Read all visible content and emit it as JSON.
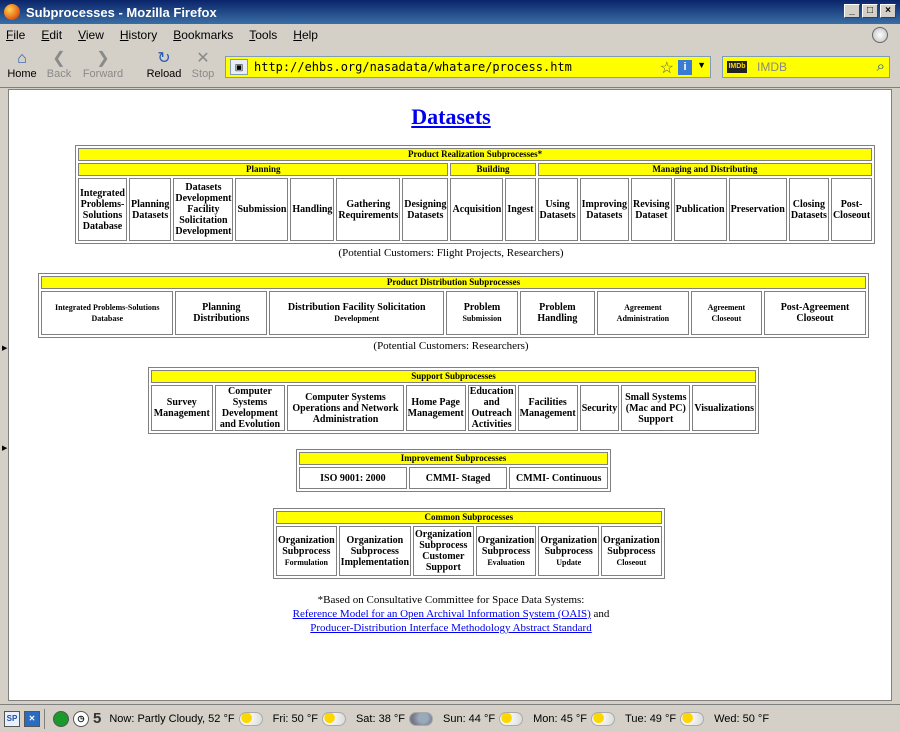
{
  "window": {
    "title": "Subprocesses - Mozilla Firefox"
  },
  "menu": [
    "File",
    "Edit",
    "View",
    "History",
    "Bookmarks",
    "Tools",
    "Help"
  ],
  "nav": {
    "home": "Home",
    "back": "Back",
    "forward": "Forward",
    "reload": "Reload",
    "stop": "Stop",
    "url": "http://ehbs.org/nasadata/whatare/process.htm",
    "search_placeholder": "IMDB",
    "search_engine": "IMDb"
  },
  "page": {
    "title": "Datasets",
    "realization": {
      "header": "Product Realization Subprocesses*",
      "groups": [
        "Planning",
        "Building",
        "Managing and Distributing"
      ],
      "items": [
        "Integrated Problems-Solutions Database",
        "Planning Datasets",
        "Datasets Development Facility Solicitation Development",
        "Submission",
        "Handling",
        "Gathering Requirements",
        "Designing Datasets",
        "Acquisition",
        "Ingest",
        "Using Datasets",
        "Improving Datasets",
        "Revising Dataset",
        "Publication",
        "Preservation",
        "Closing Datasets",
        "Post-Closeout"
      ],
      "caption": "(Potential Customers: Flight Projects, Researchers)"
    },
    "distribution": {
      "header": "Product Distribution Subprocesses",
      "items": [
        {
          "main": "Integrated Problems-Solutions Database",
          "sub": ""
        },
        {
          "main": "Planning Distributions",
          "sub": ""
        },
        {
          "main": "Distribution Facility Solicitation",
          "sub": "Development"
        },
        {
          "main": "Problem",
          "sub": "Submission"
        },
        {
          "main": "Problem Handling",
          "sub": ""
        },
        {
          "main": "Agreement",
          "sub": "Administration"
        },
        {
          "main": "Agreement",
          "sub": "Closeout"
        },
        {
          "main": "Post-Agreement Closeout",
          "sub": ""
        }
      ],
      "caption": "(Potential Customers: Researchers)"
    },
    "support": {
      "header": "Support Subprocesses",
      "items": [
        "Survey Management",
        "Computer Systems Development and Evolution",
        "Computer Systems Operations and Network Administration",
        "Home Page Management",
        "Education and Outreach Activities",
        "Facilities Management",
        "Security",
        "Small Systems (Mac and PC) Support",
        "Visualizations"
      ]
    },
    "improvement": {
      "header": "Improvement Subprocesses",
      "items": [
        "ISO 9001: 2000",
        "CMMI- Staged",
        "CMMI- Continuous"
      ]
    },
    "common": {
      "header": "Common Subprocesses",
      "items": [
        {
          "main": "Organization Subprocess",
          "sub": "Formulation"
        },
        {
          "main": "Organization Subprocess Implementation",
          "sub": ""
        },
        {
          "main": "Organization Subprocess Customer Support",
          "sub": ""
        },
        {
          "main": "Organization Subprocess",
          "sub": "Evaluation"
        },
        {
          "main": "Organization Subprocess",
          "sub": "Update"
        },
        {
          "main": "Organization Subprocess",
          "sub": "Closeout"
        }
      ]
    },
    "footer": {
      "note": "*Based on Consultative Committee for Space Data Systems:",
      "link1": "Reference Model for an Open Archival Information System (OAIS)",
      "and": "and",
      "link2": "Producer-Distribution Interface Methodology Abstract Standard"
    }
  },
  "status": {
    "count": "5",
    "weather": [
      {
        "label": "Now: Partly Cloudy, 52 °F",
        "icon": "partly-cloudy"
      },
      {
        "label": "Fri: 50 °F",
        "icon": "partly-cloudy"
      },
      {
        "label": "Sat: 38 °F",
        "icon": "rain"
      },
      {
        "label": "Sun: 44 °F",
        "icon": "partly-cloudy"
      },
      {
        "label": "Mon: 45 °F",
        "icon": "partly-cloudy"
      },
      {
        "label": "Tue: 49 °F",
        "icon": "partly-cloudy"
      },
      {
        "label": "Wed: 50 °F",
        "icon": "partly-cloudy"
      }
    ]
  }
}
